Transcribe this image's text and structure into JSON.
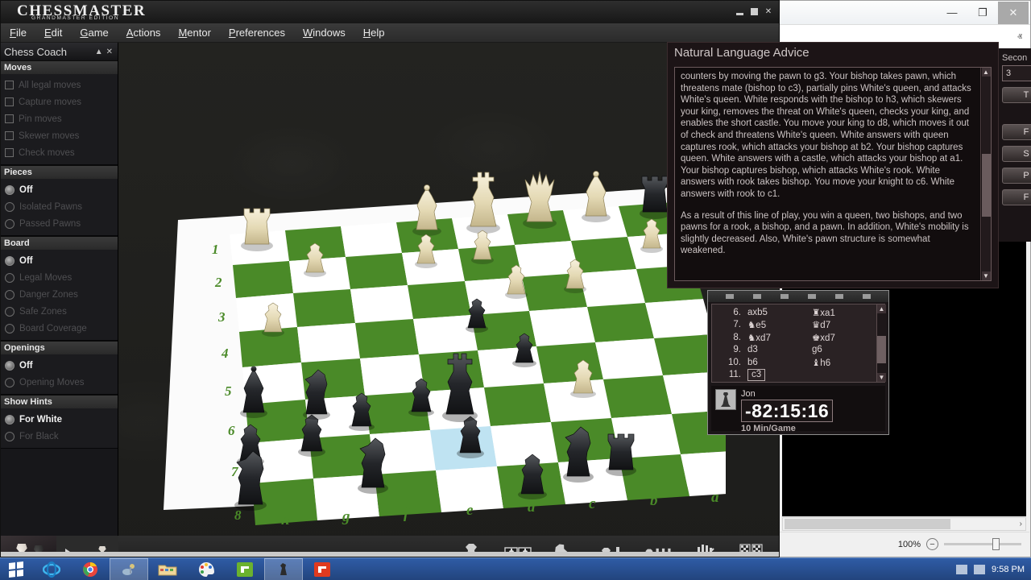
{
  "app": {
    "brand_main": "CHESSMASTER",
    "brand_sub": "GRANDMASTER EDITION",
    "window_buttons": {
      "minimize": "minimize-icon",
      "restore": "restore-icon",
      "close": "✕"
    }
  },
  "menu": {
    "items": [
      {
        "label": "File",
        "accel": "F"
      },
      {
        "label": "Edit",
        "accel": "E"
      },
      {
        "label": "Game",
        "accel": "G"
      },
      {
        "label": "Actions",
        "accel": "A"
      },
      {
        "label": "Mentor",
        "accel": "M"
      },
      {
        "label": "Preferences",
        "accel": "P"
      },
      {
        "label": "Windows",
        "accel": "W"
      },
      {
        "label": "Help",
        "accel": "H"
      }
    ]
  },
  "coach": {
    "title": "Chess Coach",
    "collapse_icon": "▲",
    "close_icon": "✕",
    "groups": [
      {
        "name": "Moves",
        "type": "checkbox",
        "options": [
          {
            "label": "All legal moves",
            "checked": false
          },
          {
            "label": "Capture moves",
            "checked": false
          },
          {
            "label": "Pin moves",
            "checked": false
          },
          {
            "label": "Skewer moves",
            "checked": false
          },
          {
            "label": "Check moves",
            "checked": false
          }
        ]
      },
      {
        "name": "Pieces",
        "type": "radio",
        "options": [
          {
            "label": "Off",
            "checked": true
          },
          {
            "label": "Isolated Pawns",
            "checked": false
          },
          {
            "label": "Passed Pawns",
            "checked": false
          }
        ]
      },
      {
        "name": "Board",
        "type": "radio",
        "options": [
          {
            "label": "Off",
            "checked": true
          },
          {
            "label": "Legal Moves",
            "checked": false
          },
          {
            "label": "Danger Zones",
            "checked": false
          },
          {
            "label": "Safe Zones",
            "checked": false
          },
          {
            "label": "Board Coverage",
            "checked": false
          }
        ]
      },
      {
        "name": "Openings",
        "type": "radio",
        "options": [
          {
            "label": "Off",
            "checked": true
          },
          {
            "label": "Opening Moves",
            "checked": false
          }
        ]
      },
      {
        "name": "Show Hints",
        "type": "radio",
        "options": [
          {
            "label": "For White",
            "checked": true
          },
          {
            "label": "For Black",
            "checked": false
          }
        ]
      }
    ]
  },
  "board": {
    "files": [
      "h",
      "g",
      "f",
      "e",
      "d",
      "c",
      "b",
      "a"
    ],
    "ranks": [
      "1",
      "2",
      "3",
      "4",
      "5",
      "6",
      "7",
      "8"
    ],
    "light_color": "#ffffff",
    "dark_color": "#4a8a28",
    "border_color": "#fbfbfb",
    "coord_color": "#4a8a28",
    "highlight_color": "#bfe3f2"
  },
  "advice": {
    "title": "Natural Language Advice",
    "paragraph1": "counters by moving the pawn to g3. Your bishop takes pawn, which threatens mate (bishop to c3), partially pins White's queen, and attacks White's queen. White responds with the bishop to h3, which skewers your king, removes the threat on White's queen, checks your king, and enables the short castle. You move your king to d8, which moves it out of check and threatens White's queen. White answers with queen captures rook, which attacks your bishop at b2. Your bishop captures queen. White answers with a castle, which attacks your bishop at a1. Your bishop captures bishop, which attacks White's rook. White answers with rook takes bishop. You move your knight to c6. White answers with rook to c1.",
    "paragraph2": "As a result of this line of play, you win a queen, two bishops, and two pawns for a rook, a bishop, and a pawn. In addition, White's mobility is slightly decreased. Also, White's pawn structure is somewhat weakened.",
    "scroll_up_icon": "▲",
    "scroll_down_icon": "▼"
  },
  "moves": {
    "rows": [
      {
        "no": "6.",
        "white": "axb5",
        "black": "♜xa1",
        "selected": false
      },
      {
        "no": "7.",
        "white": "♞e5",
        "black": "♛d7",
        "selected": false
      },
      {
        "no": "8.",
        "white": "♞xd7",
        "black": "♚xd7",
        "selected": false
      },
      {
        "no": "9.",
        "white": "d3",
        "black": "g6",
        "selected": false
      },
      {
        "no": "10.",
        "white": "b6",
        "black": "♝h6",
        "selected": false
      },
      {
        "no": "11.",
        "white": "c3",
        "black": "",
        "selected": true
      }
    ],
    "scroll_up_icon": "▲",
    "scroll_down_icon": "▼"
  },
  "clock": {
    "player_name": "Jon",
    "time": "-82:15:16",
    "time_control": "10 Min/Game",
    "avatar": "black-pawn-icon"
  },
  "side_panel": {
    "seconds_label": "Secon",
    "seconds_value": "3",
    "buttons": [
      "T",
      "F",
      "S",
      "P",
      "F"
    ]
  },
  "toolbar": {
    "icons": [
      {
        "name": "pawn-baseline-icon",
        "glyph": "♟"
      },
      {
        "name": "two-kings-icon",
        "glyph": "♚♚"
      },
      {
        "name": "captured-pieces-icon",
        "glyph": "♟"
      },
      {
        "name": "pawn-move-arrow-icon",
        "glyph": "♟"
      },
      {
        "name": "multi-move-arrows-icon",
        "glyph": "♟"
      },
      {
        "name": "stop-hand-icon",
        "glyph": "✋"
      },
      {
        "name": "flip-board-icon",
        "glyph": "▦"
      }
    ]
  },
  "background_window": {
    "minimize_icon": "—",
    "restore_icon": "❐",
    "close_icon": "✕",
    "collapse_icon": "ⱏ",
    "zoom_label": "100%",
    "zoom_minus": "−",
    "hscroll_right_icon": "›"
  },
  "taskbar": {
    "clock": "9:58 PM",
    "start_label": "start-button",
    "apps": [
      {
        "name": "internet-explorer-icon",
        "color": "#1d9bd1",
        "active": false
      },
      {
        "name": "chrome-icon",
        "color": "#e8453c",
        "active": false
      },
      {
        "name": "media-app-icon",
        "color": "#c9d7e8",
        "active": true
      },
      {
        "name": "explorer-folder-icon",
        "color": "#f3d184",
        "active": false
      },
      {
        "name": "paint-icon",
        "color": "#e8c23a",
        "active": false
      },
      {
        "name": "camtasia-green-icon",
        "color": "#6bb22e",
        "active": false
      },
      {
        "name": "chessmaster-icon",
        "color": "#2b2b2b",
        "active": true
      },
      {
        "name": "camtasia-red-icon",
        "color": "#e03a1f",
        "active": false
      }
    ]
  }
}
